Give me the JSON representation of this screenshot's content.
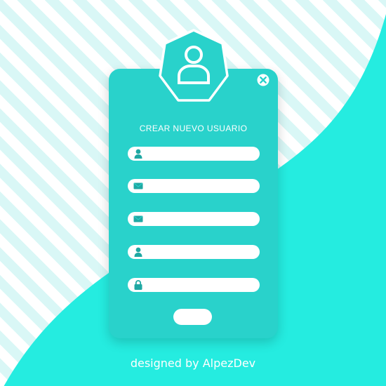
{
  "form": {
    "title": "CREAR NUEVO USUARIO",
    "submit_label": "",
    "fields": [
      {
        "icon": "user-icon",
        "value": "",
        "placeholder": ""
      },
      {
        "icon": "mail-icon",
        "value": "",
        "placeholder": ""
      },
      {
        "icon": "mail-icon",
        "value": "",
        "placeholder": ""
      },
      {
        "icon": "user-icon",
        "value": "",
        "placeholder": ""
      },
      {
        "icon": "lock-icon",
        "value": "",
        "placeholder": ""
      }
    ]
  },
  "avatar": {
    "icon": "avatar-user-icon"
  },
  "close": {
    "icon": "close-icon"
  },
  "footer": {
    "credit": "designed by AlpezDev"
  },
  "colors": {
    "accent": "#29d2cb",
    "wave": "#25ece0",
    "stripe": "#d9f7f6",
    "icon_dark": "#1fa8a3"
  }
}
